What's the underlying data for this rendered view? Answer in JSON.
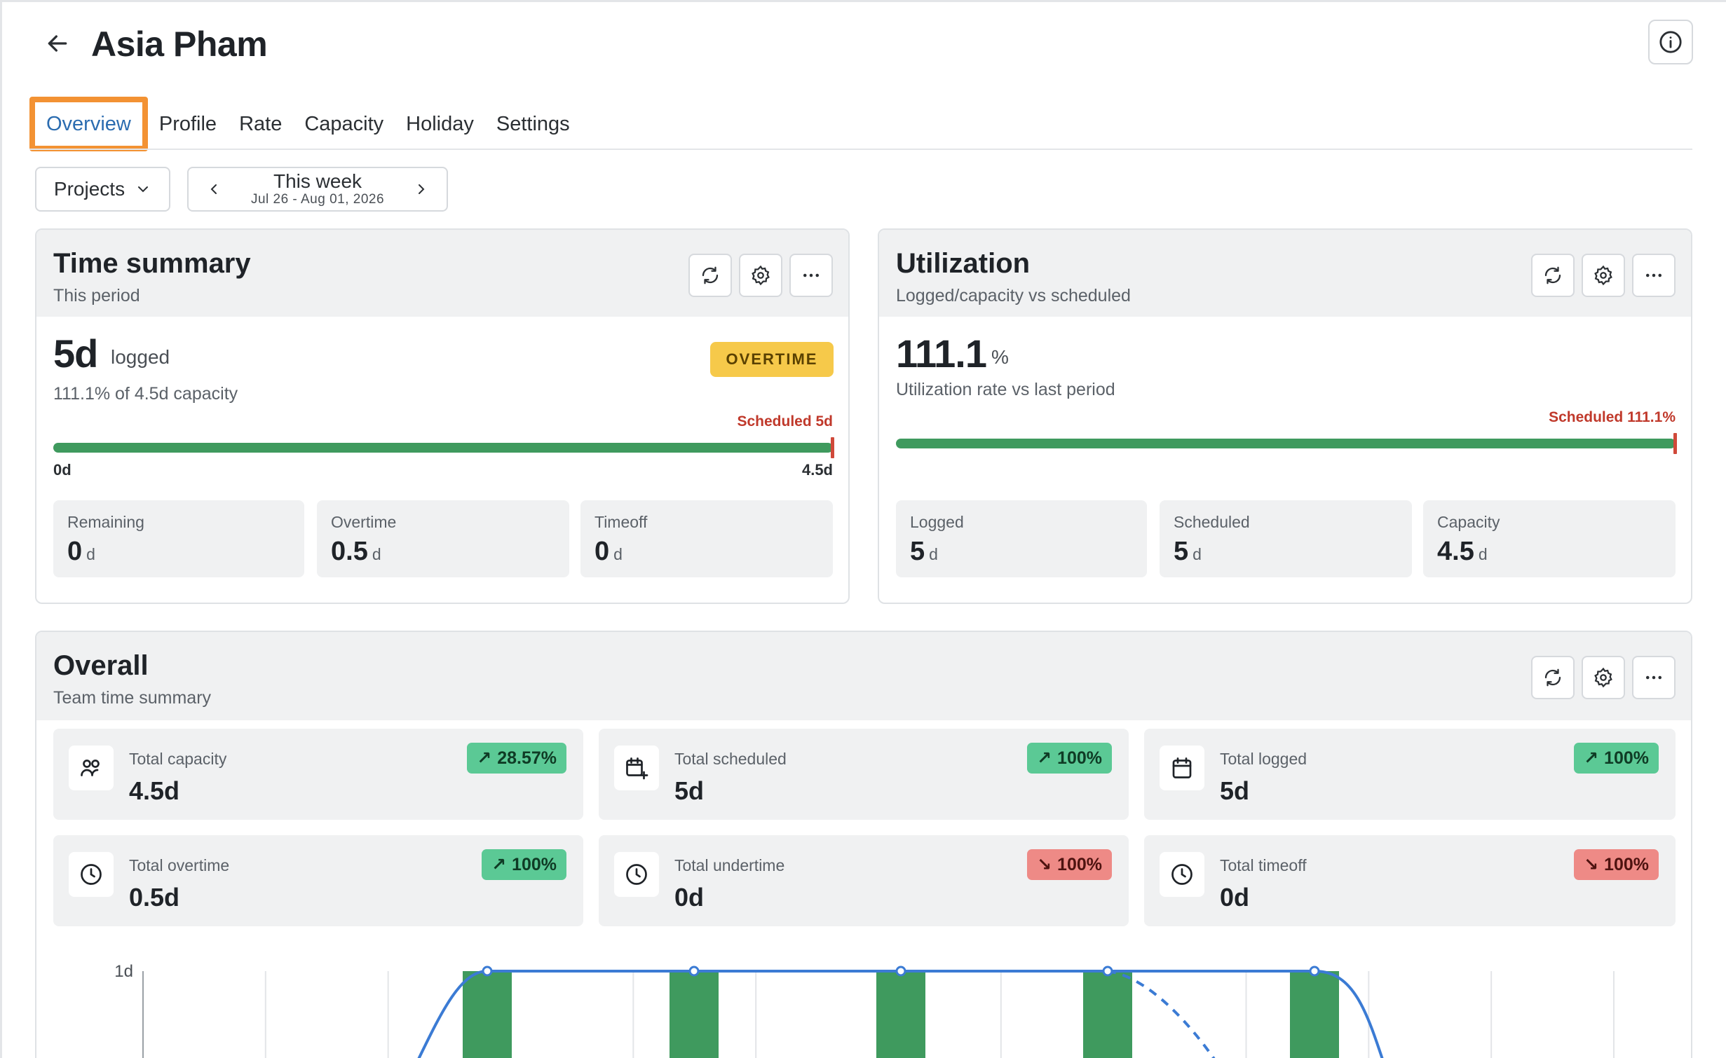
{
  "header": {
    "title": "Asia Pham"
  },
  "tabs": [
    {
      "label": "Overview",
      "active": true
    },
    {
      "label": "Profile"
    },
    {
      "label": "Rate"
    },
    {
      "label": "Capacity"
    },
    {
      "label": "Holiday"
    },
    {
      "label": "Settings"
    }
  ],
  "filters": {
    "projects_label": "Projects",
    "week_label": "This week",
    "week_range": "Jul 26 - Aug 01, 2026"
  },
  "time_summary": {
    "title": "Time summary",
    "subtitle": "This period",
    "logged_value": "5d",
    "logged_unit": "logged",
    "capacity_note": "111.1% of 4.5d capacity",
    "badge": "OVERTIME",
    "scheduled_label": "Scheduled 5d",
    "bar_min": "0d",
    "bar_max": "4.5d",
    "bar_fill_fraction": 1.0,
    "stats": [
      {
        "label": "Remaining",
        "value": "0",
        "unit": "d"
      },
      {
        "label": "Overtime",
        "value": "0.5",
        "unit": "d"
      },
      {
        "label": "Timeoff",
        "value": "0",
        "unit": "d"
      }
    ]
  },
  "utilization": {
    "title": "Utilization",
    "subtitle": "Logged/capacity vs scheduled",
    "rate_value": "111.1",
    "rate_unit": "%",
    "rate_note": "Utilization rate vs last period",
    "scheduled_label": "Scheduled 111.1%",
    "bar_fill_fraction": 1.0,
    "stats": [
      {
        "label": "Logged",
        "value": "5",
        "unit": "d"
      },
      {
        "label": "Scheduled",
        "value": "5",
        "unit": "d"
      },
      {
        "label": "Capacity",
        "value": "4.5",
        "unit": "d"
      }
    ]
  },
  "overall": {
    "title": "Overall",
    "subtitle": "Team time summary",
    "kpis": [
      {
        "label": "Total capacity",
        "value": "4.5d",
        "change": "28.57%",
        "direction": "up",
        "icon": "users-icon"
      },
      {
        "label": "Total scheduled",
        "value": "5d",
        "change": "100%",
        "direction": "up",
        "icon": "calendar-plus-icon"
      },
      {
        "label": "Total logged",
        "value": "5d",
        "change": "100%",
        "direction": "up",
        "icon": "calendar-icon"
      },
      {
        "label": "Total overtime",
        "value": "0.5d",
        "change": "100%",
        "direction": "up",
        "icon": "clock-icon"
      },
      {
        "label": "Total undertime",
        "value": "0d",
        "change": "100%",
        "direction": "down",
        "icon": "clock-icon"
      },
      {
        "label": "Total timeoff",
        "value": "0d",
        "change": "100%",
        "direction": "down",
        "icon": "clock-icon"
      }
    ]
  },
  "chart_data": {
    "type": "bar",
    "y_tick_labels": [
      "1d"
    ],
    "ylim": [
      0,
      1
    ],
    "bar_values": [
      1,
      1,
      1,
      1,
      1
    ],
    "line_points": [
      1,
      1,
      1,
      1,
      1
    ],
    "colors": {
      "bar": "#3f9a5e",
      "line": "#3b7bd4"
    }
  },
  "colors": {
    "accent": "#2b6cb0",
    "highlight": "#f39233",
    "overtime_badge": "#f6c94a",
    "bar_fill": "#3f9a5e",
    "scheduled_marker": "#d0493a",
    "badge_up": "#5bc995",
    "badge_down": "#ee8a86"
  }
}
